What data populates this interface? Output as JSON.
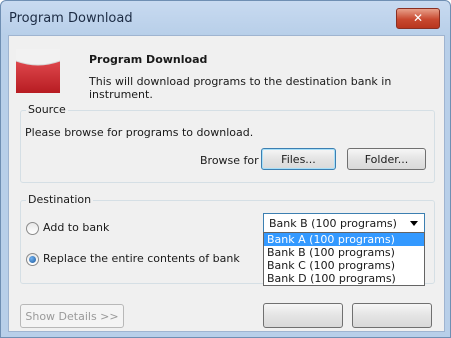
{
  "window": {
    "title": "Program Download",
    "close_label": "✕"
  },
  "header": {
    "title": "Program Download",
    "description": "This will download programs to the destination bank in instrument."
  },
  "source": {
    "label": "Source",
    "prompt": "Please browse for programs to download.",
    "browse_label": "Browse for",
    "files_button": "Files...",
    "folder_button": "Folder..."
  },
  "destination": {
    "label": "Destination",
    "add_option": "Add to bank",
    "replace_option": "Replace the entire contents of bank",
    "selected_value": "Bank B (100 programs)",
    "options": [
      "Bank A (100 programs)",
      "Bank B (100 programs)",
      "Bank C (100 programs)",
      "Bank D (100 programs)"
    ],
    "highlighted_option": "Bank A (100 programs)"
  },
  "footer": {
    "show_details": "Show Details >>"
  },
  "colors": {
    "accent": "#3399ff",
    "close": "#c8482f",
    "logo_red": "#c8252c"
  }
}
